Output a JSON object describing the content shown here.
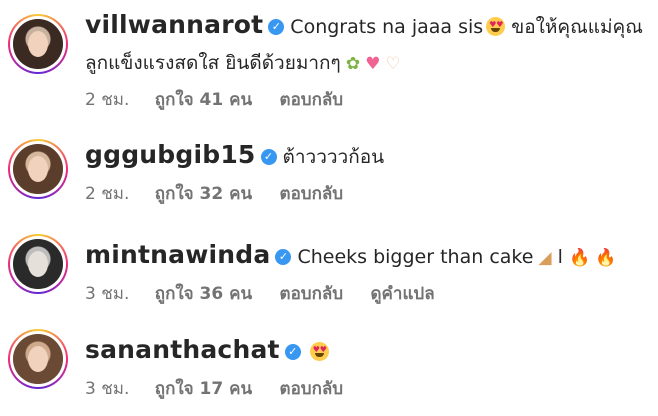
{
  "comments": [
    {
      "username": "villwannarot",
      "text_part1": "Congrats na jaaa sis",
      "text_part2": " ขอให้คุณแม่คุณ",
      "text_line2": "ลูกแข็งแรงสดใส ยินดีด้วยมากๆ",
      "time": "2 ชม.",
      "likes": "ถูกใจ 41 คน",
      "reply": "ตอบกลับ",
      "emojis": [
        "heart-eyes-emoji",
        "bouquet-emoji",
        "sparkling-heart-emoji",
        "heart-hands-emoji"
      ],
      "avatar_hair": "#3b2a22"
    },
    {
      "username": "gggubgib15",
      "text_part1": "ต้าววววก้อน",
      "time": "2 ชม.",
      "likes": "ถูกใจ 32 คน",
      "reply": "ตอบกลับ",
      "avatar_hair": "#5a3d2b"
    },
    {
      "username": "mintnawinda",
      "text_part1": "Cheeks bigger than cake",
      "text_part2": " l ",
      "time": "3 ชม.",
      "likes": "ถูกใจ 36 คน",
      "reply": "ตอบกลับ",
      "translate": "ดูคำแปล",
      "emojis": [
        "cake-emoji",
        "fire-emoji",
        "fire-emoji"
      ],
      "avatar_hair": "#2a2a2a"
    },
    {
      "username": "sananthachat",
      "time": "3 ชม.",
      "likes": "ถูกใจ 17 คน",
      "reply": "ตอบกลับ",
      "emojis": [
        "heart-eyes-emoji"
      ],
      "avatar_hair": "#6b4a35"
    }
  ],
  "icons": {
    "verified_glyph": "✓",
    "bouquet_glyph": "✿",
    "heart_glyph": "♥",
    "hands_glyph": "♡",
    "cake_glyph": "◢",
    "fire_glyph": "🔥"
  },
  "colors": {
    "verified": "#3897f0",
    "meta_text": "#737373",
    "primary_text": "#262626"
  }
}
